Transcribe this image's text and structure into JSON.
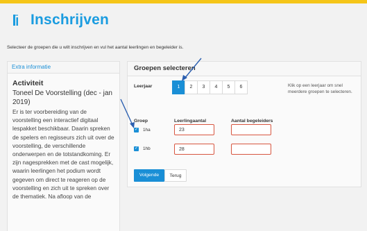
{
  "header": {
    "title": "Inschrijven",
    "accent_color": "#1a9ce0",
    "topbar_color": "#f5c518",
    "icon": "document-icon"
  },
  "intro": "Selecteer de groepen die u wilt inschrijven en vul het aantal leerlingen en begeleider is.",
  "left_panel": {
    "tab_label": "Extra informatie",
    "heading": "Activiteit",
    "activity_title": "Toneel De Voorstelling (dec - jan 2019)",
    "description": "Er is ter voorbereiding van de voorstelling een interactief digitaal lespakket beschikbaar. Daarin spreken de spelers en regisseurs zich uit over de voorstelling, de verschillende onderwerpen en de totstandkoming. Er zijn nagesprekken met de cast mogelijk, waarin leerlingen het podium wordt gegeven om direct te reageren op de voorstelling en zich uit te spreken over de thematiek. Na afloop van de"
  },
  "right_panel": {
    "title": "Groepen selecteren",
    "leerjaar_label": "Leerjaar",
    "leerjaar_options": [
      "1",
      "2",
      "3",
      "4",
      "5",
      "6"
    ],
    "leerjaar_selected": "1",
    "hint": "Klik op een leerjaar om snel meerdere groepen te selecteren.",
    "col_groep": "Groep",
    "col_leerlingaantal": "Leerlingaantal",
    "col_begeleiders": "Aantal begeleiders",
    "rows": [
      {
        "groep": "1ha",
        "checked": true,
        "leerlingaantal": "23",
        "begeleiders": ""
      },
      {
        "groep": "1hb",
        "checked": true,
        "leerlingaantal": "28",
        "begeleiders": ""
      }
    ],
    "next_button": "Volgende",
    "back_button": "Terug"
  }
}
